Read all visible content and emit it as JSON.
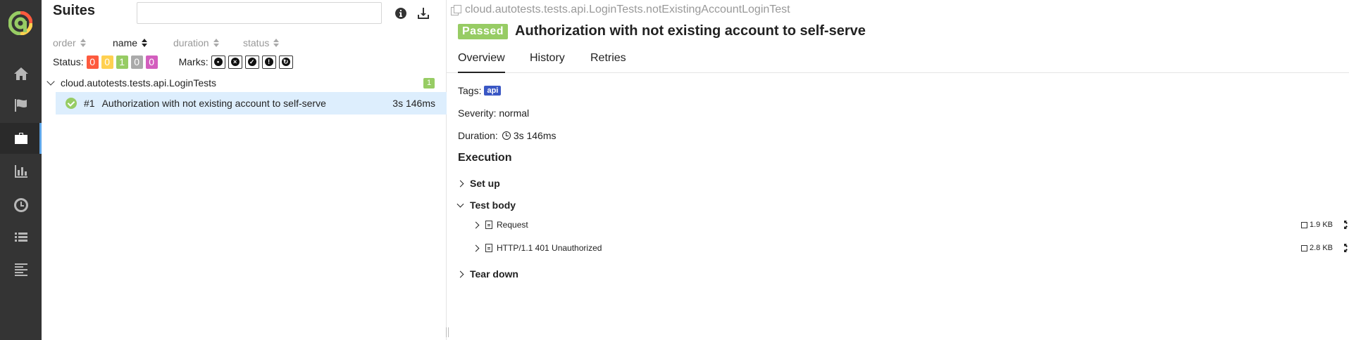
{
  "sidebar": {
    "logo": "allure-logo",
    "items": [
      {
        "icon": "home-icon",
        "active": false
      },
      {
        "icon": "flag-icon",
        "active": false
      },
      {
        "icon": "briefcase-icon",
        "active": true
      },
      {
        "icon": "bar-chart-icon",
        "active": false
      },
      {
        "icon": "clock-icon",
        "active": false
      },
      {
        "icon": "list-icon",
        "active": false
      },
      {
        "icon": "lines-icon",
        "active": false
      }
    ]
  },
  "left": {
    "title": "Suites",
    "search": {
      "value": "",
      "placeholder": ""
    },
    "header_icons": [
      "info-icon",
      "download-icon"
    ],
    "sort": {
      "order": "order",
      "name": "name",
      "duration": "duration",
      "status": "status"
    },
    "filter": {
      "status_label": "Status:",
      "statuses": [
        {
          "value": "0",
          "color": "#fd5a3e"
        },
        {
          "value": "0",
          "color": "#ffd050"
        },
        {
          "value": "1",
          "color": "#97cc64"
        },
        {
          "value": "0",
          "color": "#aaaaaa"
        },
        {
          "value": "0",
          "color": "#d35ebe"
        }
      ],
      "marks_label": "Marks:",
      "marks": [
        "flaky-icon",
        "new-failed-icon",
        "new-passed-icon",
        "new-broken-icon",
        "retries-icon"
      ]
    },
    "tree": {
      "group": {
        "name": "cloud.autotests.tests.api.LoginTests",
        "count": "1"
      },
      "tests": [
        {
          "num": "#1",
          "name": "Authorization with not existing account to self-serve",
          "duration": "3s 146ms"
        }
      ]
    }
  },
  "right": {
    "path": "cloud.autotests.tests.api.LoginTests.notExistingAccountLoginTest",
    "status": "Passed",
    "status_color": "#97cc64",
    "title": "Authorization with not existing account to self-serve",
    "tabs": [
      "Overview",
      "History",
      "Retries"
    ],
    "tags_label": "Tags:",
    "tag": "api",
    "tag_color": "#3a57c4",
    "severity": "Severity: normal",
    "duration_label": "Duration:",
    "duration": "3s 146ms",
    "execution_title": "Execution",
    "steps": {
      "setup": "Set up",
      "body": "Test body",
      "teardown": "Tear down"
    },
    "attachments": [
      {
        "name": "Request",
        "size": "1.9 KB"
      },
      {
        "name": "HTTP/1.1 401 Unauthorized",
        "size": "2.8 KB"
      }
    ]
  }
}
